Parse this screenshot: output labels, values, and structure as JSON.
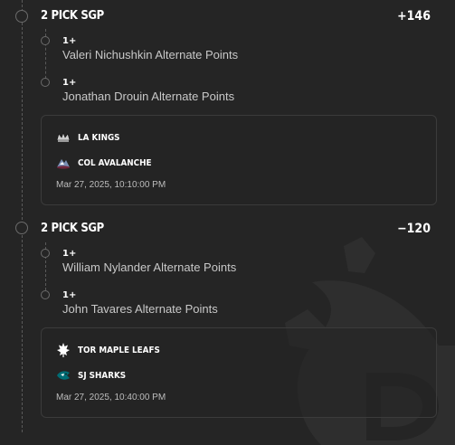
{
  "bets": [
    {
      "title": "2 PICK SGP",
      "odds": "+146",
      "legs": [
        {
          "qty": "1+",
          "name": "Valeri Nichushkin Alternate Points"
        },
        {
          "qty": "1+",
          "name": "Jonathan Drouin Alternate Points"
        }
      ],
      "game": {
        "teams": [
          {
            "name": "LA KINGS",
            "logo": "la-kings-logo"
          },
          {
            "name": "COL AVALANCHE",
            "logo": "col-avalanche-logo"
          }
        ],
        "time": "Mar 27, 2025, 10:10:00 PM"
      }
    },
    {
      "title": "2 PICK SGP",
      "odds": "−120",
      "legs": [
        {
          "qty": "1+",
          "name": "William Nylander Alternate Points"
        },
        {
          "qty": "1+",
          "name": "John Tavares Alternate Points"
        }
      ],
      "game": {
        "teams": [
          {
            "name": "TOR MAPLE LEAFS",
            "logo": "tor-maple-leafs-logo"
          },
          {
            "name": "SJ SHARKS",
            "logo": "sj-sharks-logo"
          }
        ],
        "time": "Mar 27, 2025, 10:40:00 PM"
      }
    }
  ],
  "colors": {
    "background": "#252525",
    "text": "#ffffff",
    "muted_text": "#c8c8c8",
    "card_border": "#3b3b3b"
  }
}
